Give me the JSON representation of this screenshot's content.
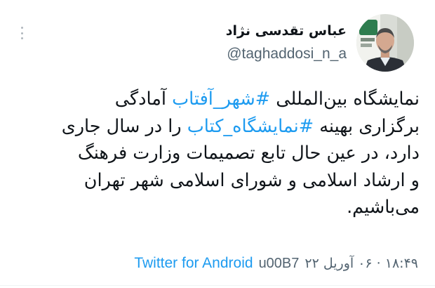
{
  "tweet": {
    "author": {
      "display_name": "عباس تقدسی نژاد",
      "handle": "@taghaddosi_n_a"
    },
    "body_lines": [
      [
        {
          "text": "نمایشگاه بین‌المللی ",
          "hashtag": false
        },
        {
          "text": "#شهر_آفتاب",
          "hashtag": true
        },
        {
          "text": " آمادگی",
          "hashtag": false
        }
      ],
      [
        {
          "text": "برگزاری بهینه ",
          "hashtag": false
        },
        {
          "text": "#نمایشگاه_کتاب",
          "hashtag": true
        },
        {
          "text": " را در سال جاری",
          "hashtag": false
        }
      ],
      [
        {
          "text": "دارد، در عین حال تابع تصمیمات وزارت فرهنگ",
          "hashtag": false
        }
      ],
      [
        {
          "text": "و ارشاد اسلامی و شورای اسلامی شهر تهران",
          "hashtag": false
        }
      ],
      [
        {
          "text": "می‌باشیم.",
          "hashtag": false
        }
      ]
    ],
    "timestamp": "۱۸:۴۹ · ۰۶ آوریل ۲۲",
    "separator_code": "u00B7",
    "source": "Twitter for Android"
  },
  "icons": {
    "more": "more-vertical-icon",
    "avatar": "avatar-photo"
  },
  "colors": {
    "hashtag": "#1d9bf0",
    "secondary_text": "#536471",
    "primary_text": "#0f1419"
  }
}
